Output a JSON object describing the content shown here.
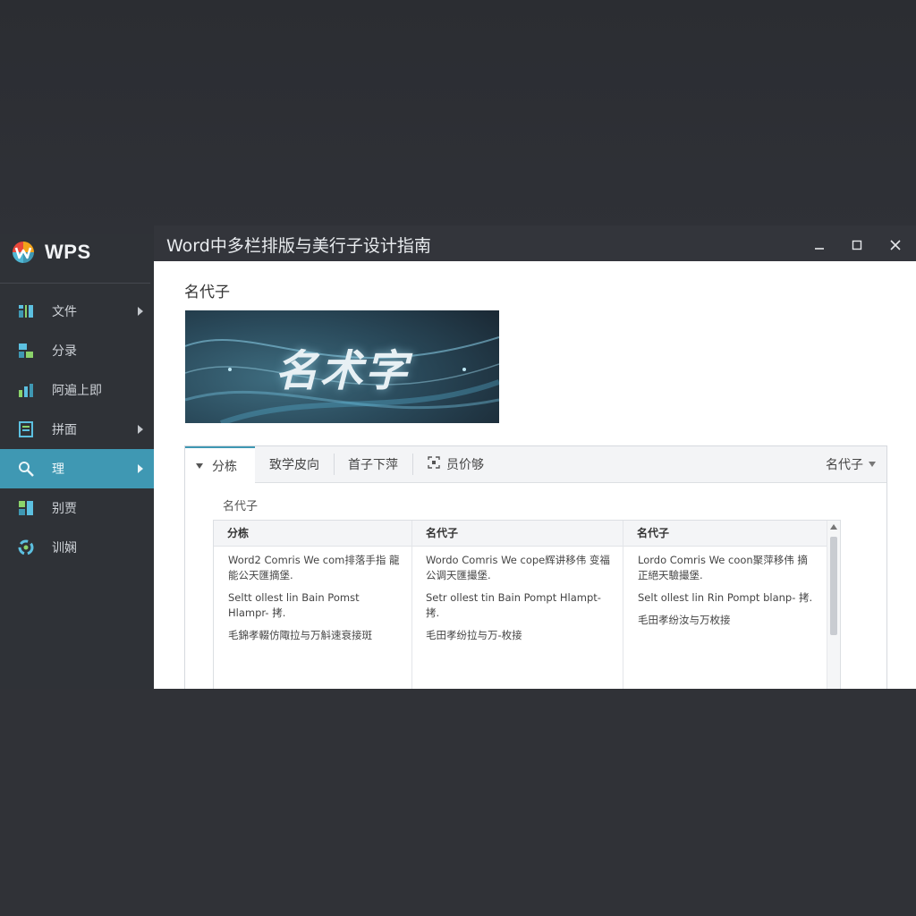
{
  "app": {
    "brand": "WPS",
    "window_title": "Word中多栏排版与美行子设计指南"
  },
  "sidebar": {
    "items": [
      {
        "label": "文件",
        "icon": "file-icon",
        "has_submenu": true,
        "active": false
      },
      {
        "label": "分录",
        "icon": "category-icon",
        "has_submenu": false,
        "active": false
      },
      {
        "label": "阿遍上即",
        "icon": "chart-icon",
        "has_submenu": false,
        "active": false
      },
      {
        "label": "拼面",
        "icon": "document-icon",
        "has_submenu": true,
        "active": false
      },
      {
        "label": "理",
        "icon": "search-icon",
        "has_submenu": true,
        "active": true
      },
      {
        "label": "别贾",
        "icon": "layout-icon",
        "has_submenu": false,
        "active": false
      },
      {
        "label": "训娴",
        "icon": "refresh-icon",
        "has_submenu": false,
        "active": false
      }
    ]
  },
  "document": {
    "heading": "名代子",
    "banner_text": "名术字"
  },
  "tabs": {
    "items": [
      {
        "label": "分栋",
        "active": true
      },
      {
        "label": "致学皮向",
        "active": false
      },
      {
        "label": "首子下萍",
        "active": false
      },
      {
        "label": "员价够",
        "active": false
      }
    ],
    "right_dropdown": "名代子"
  },
  "panel": {
    "section_label": "名代子",
    "table": {
      "headers": [
        "分栋",
        "名代子",
        "名代子"
      ],
      "columns": [
        [
          "Word2 Comris We com排落手指 龍能公天匯摘堡.",
          "Seltt ollest lin Bain Pomst Hlampr- 拷.",
          "毛錦孝輟仿陬拉与万斛速衰接斑"
        ],
        [
          "Wordo Comris We cope辉讲移伟 变福公调天匯撮堡.",
          "Setr ollest tin Bain Pompt Hlampt- 拷.",
          "毛田孝纷拉与万-枚接"
        ],
        [
          "Lordo Comris We coon聚萍移伟 摘正絕天驗撮堡.",
          "Selt ollest lin Rin Pompt blanp- 拷.",
          "毛田孝纷汝与万枚接"
        ]
      ]
    }
  },
  "colors": {
    "accent": "#3f98b3",
    "sidebar_bg": "#2f3237",
    "titlebar_bg": "#33353b"
  }
}
